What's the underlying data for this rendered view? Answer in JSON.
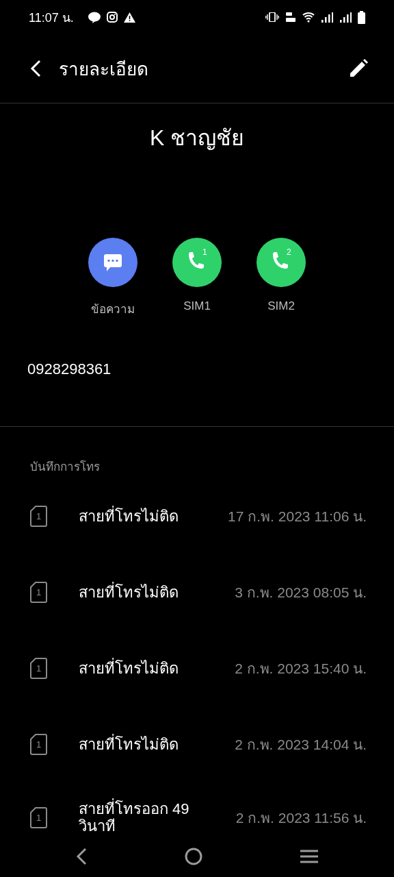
{
  "status_bar": {
    "time": "11:07 น."
  },
  "top_bar": {
    "title": "รายละเอียด"
  },
  "contact": {
    "name": "K ชาญชัย",
    "phone": "0928298361"
  },
  "actions": [
    {
      "kind": "message",
      "label": "ข้อความ",
      "color": "#5b7ef0"
    },
    {
      "kind": "call",
      "label": "SIM1",
      "sim": "1",
      "color": "#2fd16b"
    },
    {
      "kind": "call",
      "label": "SIM2",
      "sim": "2",
      "color": "#2fd16b"
    }
  ],
  "call_log": {
    "heading": "บันทึกการโทร",
    "entries": [
      {
        "sim": "1",
        "type": "สายที่โทรไม่ติด",
        "time": "17 ก.พ. 2023 11:06 น."
      },
      {
        "sim": "1",
        "type": "สายที่โทรไม่ติด",
        "time": "3 ก.พ. 2023 08:05 น."
      },
      {
        "sim": "1",
        "type": "สายที่โทรไม่ติด",
        "time": "2 ก.พ. 2023 15:40 น."
      },
      {
        "sim": "1",
        "type": "สายที่โทรไม่ติด",
        "time": "2 ก.พ. 2023 14:04 น."
      },
      {
        "sim": "1",
        "type": "สายที่โทรออก 49 วินาที",
        "time": "2 ก.พ. 2023 11:56 น."
      }
    ]
  }
}
